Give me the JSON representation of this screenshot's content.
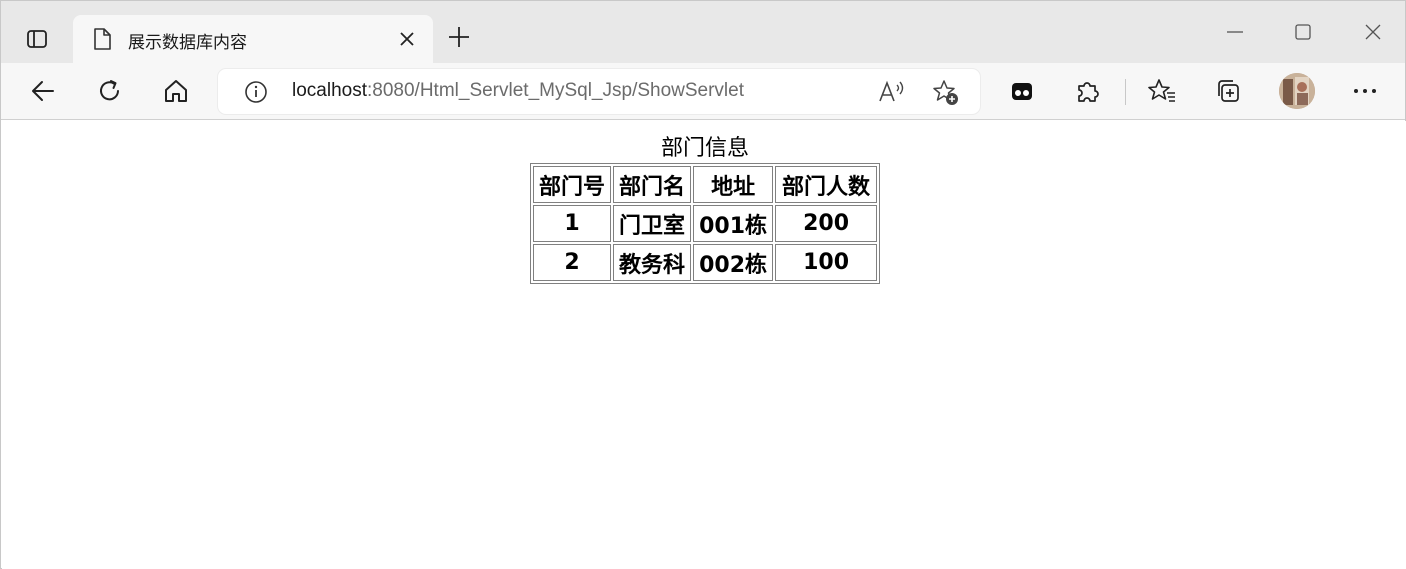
{
  "browser": {
    "tab_title": "展示数据库内容",
    "url_host": "localhost",
    "url_path": ":8080/Html_Servlet_MySql_Jsp/ShowServlet",
    "accent_color": "#1a1a1a"
  },
  "page": {
    "table_caption": "部门信息",
    "columns": [
      "部门号",
      "部门名",
      "地址",
      "部门人数"
    ],
    "rows": [
      [
        "1",
        "门卫室",
        "001栋",
        "200"
      ],
      [
        "2",
        "教务科",
        "002栋",
        "100"
      ]
    ]
  }
}
